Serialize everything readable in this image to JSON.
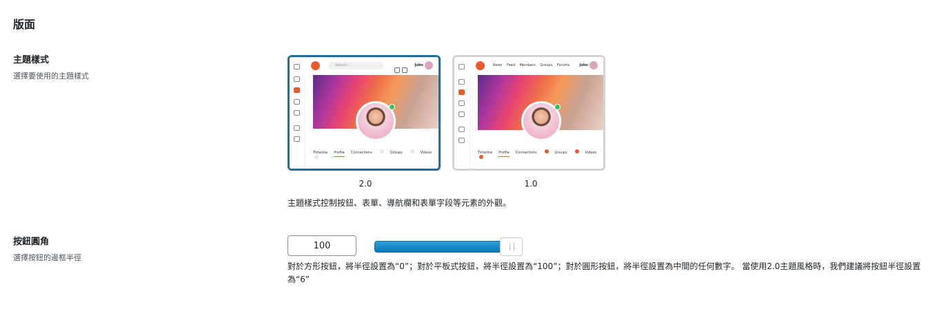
{
  "section": {
    "title": "版面"
  },
  "theme_style": {
    "label": "主題樣式",
    "description": "選擇要使用的主題樣式",
    "options": [
      {
        "label": "2.0",
        "selected": true,
        "mock": {
          "search_placeholder": "Search...",
          "user_name": "John",
          "tabs": [
            "Timeline",
            "Profile",
            "Connections",
            "Groups",
            "Videos"
          ]
        }
      },
      {
        "label": "1.0",
        "selected": false,
        "mock": {
          "nav_links": "News Feed Members Groups Forums",
          "user_name": "John",
          "tabs": [
            "Timeline",
            "Profile",
            "Connections",
            "Groups",
            "Videos"
          ]
        }
      }
    ],
    "note": "主題樣式控制按鈕、表單、導航欄和表單字段等元素的外觀。"
  },
  "button_radius": {
    "label": "按鈕圓角",
    "description": "選擇按鈕的邊框半徑",
    "value": "100",
    "slider_level": 0.86,
    "help": "對於方形按鈕，將半徑設置為“0”；對於平板式按鈕，將半徑設置為“100”；對於圓形按鈕，將半徑設置為中間的任何數字。 當使用2.0主題風格時，我們建議將按鈕半徑設置為“6”"
  },
  "colors": {
    "accent": "#1f6f9e",
    "brand": "#e85c2c",
    "slider": "#0a77b8"
  }
}
